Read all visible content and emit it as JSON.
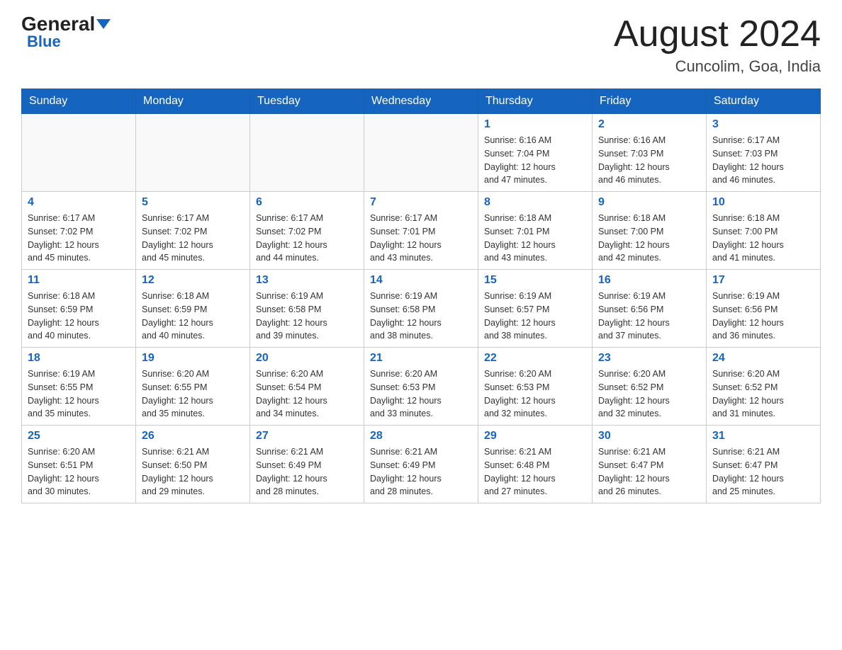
{
  "header": {
    "logo_general": "General",
    "logo_blue": "Blue",
    "main_title": "August 2024",
    "subtitle": "Cuncolim, Goa, India"
  },
  "days_of_week": [
    "Sunday",
    "Monday",
    "Tuesday",
    "Wednesday",
    "Thursday",
    "Friday",
    "Saturday"
  ],
  "weeks": [
    {
      "days": [
        {
          "number": "",
          "info": ""
        },
        {
          "number": "",
          "info": ""
        },
        {
          "number": "",
          "info": ""
        },
        {
          "number": "",
          "info": ""
        },
        {
          "number": "1",
          "info": "Sunrise: 6:16 AM\nSunset: 7:04 PM\nDaylight: 12 hours\nand 47 minutes."
        },
        {
          "number": "2",
          "info": "Sunrise: 6:16 AM\nSunset: 7:03 PM\nDaylight: 12 hours\nand 46 minutes."
        },
        {
          "number": "3",
          "info": "Sunrise: 6:17 AM\nSunset: 7:03 PM\nDaylight: 12 hours\nand 46 minutes."
        }
      ]
    },
    {
      "days": [
        {
          "number": "4",
          "info": "Sunrise: 6:17 AM\nSunset: 7:02 PM\nDaylight: 12 hours\nand 45 minutes."
        },
        {
          "number": "5",
          "info": "Sunrise: 6:17 AM\nSunset: 7:02 PM\nDaylight: 12 hours\nand 45 minutes."
        },
        {
          "number": "6",
          "info": "Sunrise: 6:17 AM\nSunset: 7:02 PM\nDaylight: 12 hours\nand 44 minutes."
        },
        {
          "number": "7",
          "info": "Sunrise: 6:17 AM\nSunset: 7:01 PM\nDaylight: 12 hours\nand 43 minutes."
        },
        {
          "number": "8",
          "info": "Sunrise: 6:18 AM\nSunset: 7:01 PM\nDaylight: 12 hours\nand 43 minutes."
        },
        {
          "number": "9",
          "info": "Sunrise: 6:18 AM\nSunset: 7:00 PM\nDaylight: 12 hours\nand 42 minutes."
        },
        {
          "number": "10",
          "info": "Sunrise: 6:18 AM\nSunset: 7:00 PM\nDaylight: 12 hours\nand 41 minutes."
        }
      ]
    },
    {
      "days": [
        {
          "number": "11",
          "info": "Sunrise: 6:18 AM\nSunset: 6:59 PM\nDaylight: 12 hours\nand 40 minutes."
        },
        {
          "number": "12",
          "info": "Sunrise: 6:18 AM\nSunset: 6:59 PM\nDaylight: 12 hours\nand 40 minutes."
        },
        {
          "number": "13",
          "info": "Sunrise: 6:19 AM\nSunset: 6:58 PM\nDaylight: 12 hours\nand 39 minutes."
        },
        {
          "number": "14",
          "info": "Sunrise: 6:19 AM\nSunset: 6:58 PM\nDaylight: 12 hours\nand 38 minutes."
        },
        {
          "number": "15",
          "info": "Sunrise: 6:19 AM\nSunset: 6:57 PM\nDaylight: 12 hours\nand 38 minutes."
        },
        {
          "number": "16",
          "info": "Sunrise: 6:19 AM\nSunset: 6:56 PM\nDaylight: 12 hours\nand 37 minutes."
        },
        {
          "number": "17",
          "info": "Sunrise: 6:19 AM\nSunset: 6:56 PM\nDaylight: 12 hours\nand 36 minutes."
        }
      ]
    },
    {
      "days": [
        {
          "number": "18",
          "info": "Sunrise: 6:19 AM\nSunset: 6:55 PM\nDaylight: 12 hours\nand 35 minutes."
        },
        {
          "number": "19",
          "info": "Sunrise: 6:20 AM\nSunset: 6:55 PM\nDaylight: 12 hours\nand 35 minutes."
        },
        {
          "number": "20",
          "info": "Sunrise: 6:20 AM\nSunset: 6:54 PM\nDaylight: 12 hours\nand 34 minutes."
        },
        {
          "number": "21",
          "info": "Sunrise: 6:20 AM\nSunset: 6:53 PM\nDaylight: 12 hours\nand 33 minutes."
        },
        {
          "number": "22",
          "info": "Sunrise: 6:20 AM\nSunset: 6:53 PM\nDaylight: 12 hours\nand 32 minutes."
        },
        {
          "number": "23",
          "info": "Sunrise: 6:20 AM\nSunset: 6:52 PM\nDaylight: 12 hours\nand 32 minutes."
        },
        {
          "number": "24",
          "info": "Sunrise: 6:20 AM\nSunset: 6:52 PM\nDaylight: 12 hours\nand 31 minutes."
        }
      ]
    },
    {
      "days": [
        {
          "number": "25",
          "info": "Sunrise: 6:20 AM\nSunset: 6:51 PM\nDaylight: 12 hours\nand 30 minutes."
        },
        {
          "number": "26",
          "info": "Sunrise: 6:21 AM\nSunset: 6:50 PM\nDaylight: 12 hours\nand 29 minutes."
        },
        {
          "number": "27",
          "info": "Sunrise: 6:21 AM\nSunset: 6:49 PM\nDaylight: 12 hours\nand 28 minutes."
        },
        {
          "number": "28",
          "info": "Sunrise: 6:21 AM\nSunset: 6:49 PM\nDaylight: 12 hours\nand 28 minutes."
        },
        {
          "number": "29",
          "info": "Sunrise: 6:21 AM\nSunset: 6:48 PM\nDaylight: 12 hours\nand 27 minutes."
        },
        {
          "number": "30",
          "info": "Sunrise: 6:21 AM\nSunset: 6:47 PM\nDaylight: 12 hours\nand 26 minutes."
        },
        {
          "number": "31",
          "info": "Sunrise: 6:21 AM\nSunset: 6:47 PM\nDaylight: 12 hours\nand 25 minutes."
        }
      ]
    }
  ]
}
